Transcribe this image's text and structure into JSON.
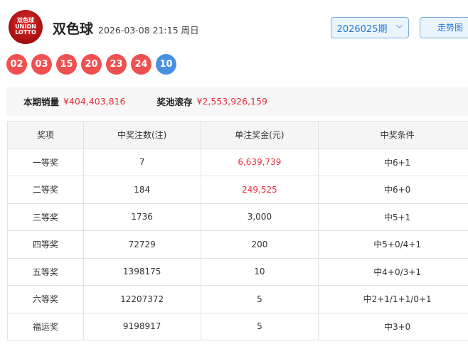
{
  "header": {
    "logo_text": [
      "双色球",
      "UNION",
      "LOTTO"
    ],
    "title": "双色球",
    "date": "2026-03-08 21:15 周日",
    "issue": "2026025期",
    "trend_button": "走势图"
  },
  "balls": {
    "red": [
      "02",
      "03",
      "15",
      "20",
      "23",
      "24"
    ],
    "blue": [
      "10"
    ]
  },
  "sales": {
    "sales_label": "本期销量",
    "sales_value": "¥404,403,816",
    "pool_label": "奖池滚存",
    "pool_value": "¥2,553,926,159"
  },
  "colors": {
    "red_ball": "#f05050",
    "blue_ball": "#4a90e2",
    "accent_red": "#e8303a"
  },
  "table": {
    "headers": [
      "奖项",
      "中奖注数(注)",
      "单注奖金(元)",
      "中奖条件"
    ],
    "rows": [
      [
        "一等奖",
        "7",
        "6,639,739",
        "中6+1"
      ],
      [
        "二等奖",
        "184",
        "249,525",
        "中6+0"
      ],
      [
        "三等奖",
        "1736",
        "3,000",
        "中5+1"
      ],
      [
        "四等奖",
        "72729",
        "200",
        "中5+0/4+1"
      ],
      [
        "五等奖",
        "1398175",
        "10",
        "中4+0/3+1"
      ],
      [
        "六等奖",
        "12207372",
        "5",
        "中2+1/1+1/0+1"
      ],
      [
        "福运奖",
        "9198917",
        "5",
        "中3+0"
      ]
    ]
  }
}
